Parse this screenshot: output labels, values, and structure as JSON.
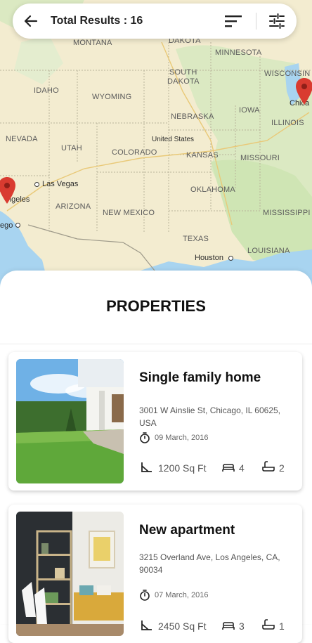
{
  "header": {
    "title": "Total Results : 16"
  },
  "map": {
    "labels": {
      "montana": "MONTANA",
      "north_dakota": "DAKOTA",
      "minnesota": "MINNESOTA",
      "wisconsin": "WISCONSIN",
      "idaho": "IDAHO",
      "wyoming": "WYOMING",
      "south_dakota_1": "SOUTH",
      "south_dakota_2": "DAKOTA",
      "iowa": "IOWA",
      "nebraska": "NEBRASKA",
      "illinois": "ILLINOIS",
      "nevada": "NEVADA",
      "utah": "UTAH",
      "colorado": "COLORADO",
      "united_states": "United States",
      "kansas": "KANSAS",
      "missouri": "MISSOURI",
      "las_vegas": "Las Vegas",
      "los_angeles": "ngeles",
      "san_diego": "ego",
      "arizona": "ARIZONA",
      "new_mexico": "NEW MEXICO",
      "oklahoma": "OKLAHOMA",
      "mississippi": "MISSISSIPPI",
      "texas": "TEXAS",
      "houston": "Houston",
      "louisiana": "LOUISIANA",
      "chicago": "Chica"
    }
  },
  "properties": {
    "title": "PROPERTIES",
    "items": [
      {
        "name": "Single family home",
        "address": "3001 W Ainslie St, Chicago, IL 60625, USA",
        "date": "09 March, 2016",
        "area": "1200 Sq Ft",
        "beds": "4",
        "baths": "2"
      },
      {
        "name": "New apartment",
        "address": "3215 Overland Ave, Los Angeles, CA, 90034",
        "date": "07 March, 2016",
        "area": "2450 Sq Ft",
        "beds": "3",
        "baths": "1"
      }
    ]
  },
  "colors": {
    "pin": "#d93b30",
    "water": "#a8d4f0",
    "land": "#f3ecd0",
    "green": "#cfe5b4"
  }
}
